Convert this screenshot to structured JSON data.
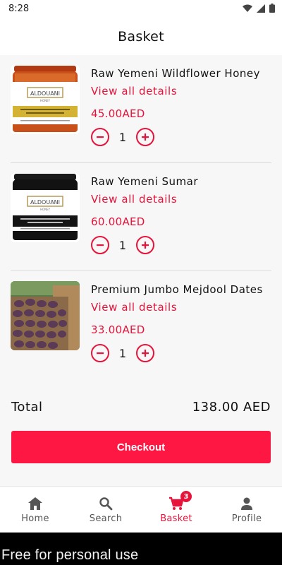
{
  "status_bar": {
    "time": "8:28"
  },
  "header": {
    "title": "Basket"
  },
  "items": [
    {
      "name": "Raw Yemeni Wildflower Honey",
      "link_label": "View all details",
      "price": "45.00AED",
      "quantity": "1",
      "image_brand": "ALDOUANI",
      "image_sub": "HONEY"
    },
    {
      "name": "Raw Yemeni Sumar",
      "link_label": "View all details",
      "price": "60.00AED",
      "quantity": "1",
      "image_brand": "ALDOUANI",
      "image_sub": "HONEY"
    },
    {
      "name": "Premium Jumbo Mejdool Dates",
      "link_label": "View all details",
      "price": "33.00AED",
      "quantity": "1"
    }
  ],
  "summary": {
    "total_label": "Total",
    "total_value": "138.00 AED"
  },
  "checkout_label": "Checkout",
  "nav": {
    "items": [
      {
        "label": "Home",
        "icon": "home-icon"
      },
      {
        "label": "Search",
        "icon": "search-icon"
      },
      {
        "label": "Basket",
        "icon": "cart-icon",
        "badge": "3",
        "active": true
      },
      {
        "label": "Profile",
        "icon": "person-icon"
      }
    ]
  },
  "watermark": "Free for personal use",
  "colors": {
    "accent": "#e8133a",
    "checkout": "#ff1744"
  }
}
